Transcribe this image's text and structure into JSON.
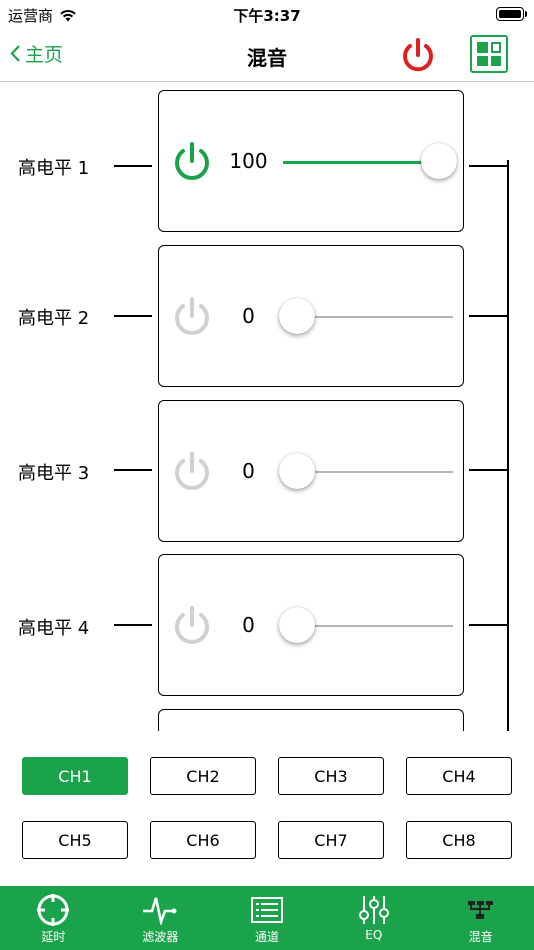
{
  "status_bar": {
    "carrier": "运营商",
    "time": "下午3:37"
  },
  "nav": {
    "back_label": "主页",
    "title": "混音"
  },
  "colors": {
    "accent": "#1aa34a",
    "power_red": "#e02020",
    "inactive": "#d0d0d0"
  },
  "channels": [
    {
      "label": "高电平 1",
      "value": "100",
      "enabled": true,
      "level_percent": 100
    },
    {
      "label": "高电平 2",
      "value": "0",
      "enabled": false,
      "level_percent": 0
    },
    {
      "label": "高电平 3",
      "value": "0",
      "enabled": false,
      "level_percent": 0
    },
    {
      "label": "高电平 4",
      "value": "0",
      "enabled": false,
      "level_percent": 0
    }
  ],
  "ch_buttons": [
    "CH1",
    "CH2",
    "CH3",
    "CH4",
    "CH5",
    "CH6",
    "CH7",
    "CH8"
  ],
  "ch_selected": "CH1",
  "tabs": [
    {
      "label": "延时",
      "icon": "crosshair-icon"
    },
    {
      "label": "滤波器",
      "icon": "waveform-icon"
    },
    {
      "label": "通道",
      "icon": "list-icon"
    },
    {
      "label": "EQ",
      "icon": "sliders-icon"
    },
    {
      "label": "混音",
      "icon": "mixer-icon"
    }
  ]
}
